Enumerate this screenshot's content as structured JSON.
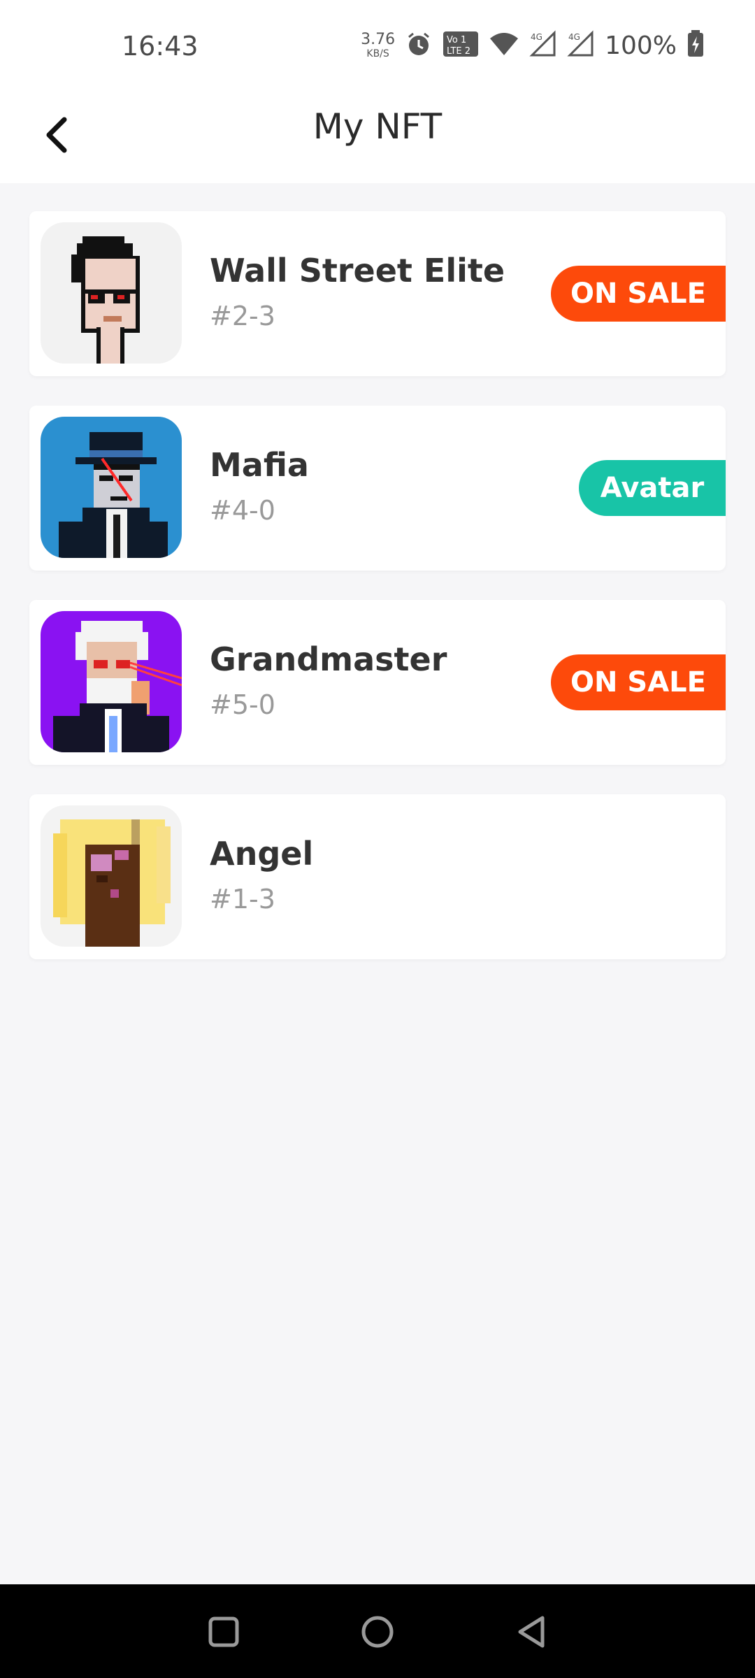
{
  "status": {
    "time": "16:43",
    "speed_value": "3.76",
    "speed_unit": "KB/S",
    "battery": "100%"
  },
  "header": {
    "title": "My NFT"
  },
  "items": [
    {
      "title": "Wall Street Elite",
      "subtitle": "#2-3",
      "badge": "ON SALE"
    },
    {
      "title": "Mafia",
      "subtitle": "#4-0",
      "badge": "Avatar"
    },
    {
      "title": "Grandmaster",
      "subtitle": "#5-0",
      "badge": "ON SALE"
    },
    {
      "title": "Angel",
      "subtitle": "#1-3"
    }
  ],
  "colors": {
    "sale_badge": "#fd4a0b",
    "avatar_badge": "#18c4a7",
    "mafia_bg": "#2b90d0",
    "grandmaster_bg": "#8a12f2"
  },
  "icons": {
    "back": "chevron-left-icon",
    "nav_recent": "square-icon",
    "nav_home": "circle-icon",
    "nav_back": "triangle-left-icon"
  }
}
